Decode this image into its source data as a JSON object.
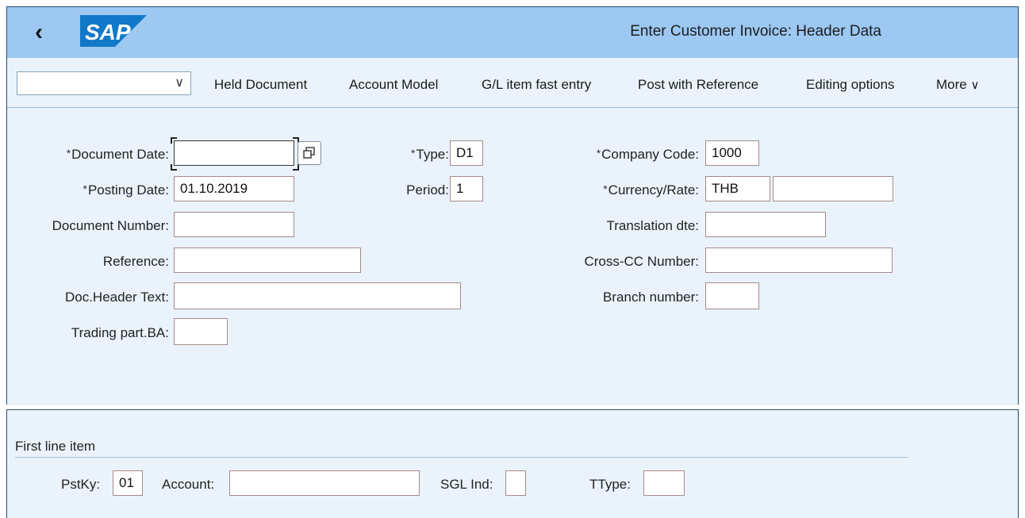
{
  "header": {
    "back_icon": "chevron-left-icon",
    "logo_text": "SAP",
    "title": "Enter Customer Invoice: Header Data",
    "colors": {
      "header_bg": "#9cc8f2",
      "content_bg": "#eaf3fc",
      "logo_blue": "#1278c8"
    }
  },
  "toolbar": {
    "variant_select_value": "",
    "buttons": [
      "Held Document",
      "Account Model",
      "G/L item fast entry",
      "Post with Reference",
      "Editing options",
      "More"
    ],
    "more_icon": "chevron-down-icon"
  },
  "form": {
    "document_date": {
      "label": "Document Date:",
      "required": true,
      "value": ""
    },
    "posting_date": {
      "label": "Posting Date:",
      "required": true,
      "value": "01.10.2019"
    },
    "document_number": {
      "label": "Document Number:",
      "value": ""
    },
    "reference": {
      "label": "Reference:",
      "value": ""
    },
    "doc_header_text": {
      "label": "Doc.Header Text:",
      "value": ""
    },
    "trading_part_ba": {
      "label": "Trading part.BA:",
      "value": ""
    },
    "type": {
      "label": "Type:",
      "required": true,
      "value": "D1"
    },
    "period": {
      "label": "Period:",
      "value": "1"
    },
    "company_code": {
      "label": "Company Code:",
      "required": true,
      "value": "1000"
    },
    "currency_rate": {
      "label": "Currency/Rate:",
      "required": true,
      "currency": "THB",
      "rate": ""
    },
    "translation_dte": {
      "label": "Translation dte:",
      "value": ""
    },
    "cross_cc_number": {
      "label": "Cross-CC Number:",
      "value": ""
    },
    "branch_number": {
      "label": "Branch number:",
      "value": ""
    },
    "required_marker": "*"
  },
  "first_line_item": {
    "title": "First line item",
    "pstky": {
      "label": "PstKy:",
      "value": "01"
    },
    "account": {
      "label": "Account:",
      "value": ""
    },
    "sgl_ind": {
      "label": "SGL Ind:",
      "value": ""
    },
    "ttype": {
      "label": "TType:",
      "value": ""
    }
  }
}
